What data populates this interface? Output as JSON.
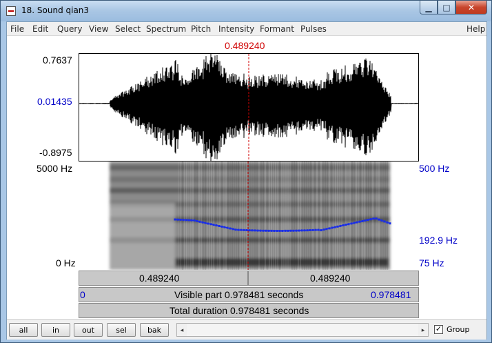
{
  "window": {
    "title": "18. Sound qian3",
    "controls": {
      "minimize": "▁",
      "maximize": "□",
      "close": "✕"
    }
  },
  "menu": [
    "File",
    "Edit",
    "Query",
    "View",
    "Select",
    "Spectrum",
    "Pitch",
    "Intensity",
    "Formant",
    "Pulses",
    "Help"
  ],
  "cursor": {
    "time_label": "0.489240",
    "position_fraction": 0.5,
    "color": "#d00000"
  },
  "waveform": {
    "max_label": "0.7637",
    "zero_label": "0.01435",
    "min_label": "-0.8975"
  },
  "spectrogram": {
    "freq_max_label": "5000 Hz",
    "freq_min_label": "0 Hz",
    "pitch_max_label": "500 Hz",
    "pitch_mid_label": "192.9 Hz",
    "pitch_min_label": "75 Hz",
    "pitch_color": "#1a2ee6"
  },
  "selection": {
    "left_label": "0.489240",
    "right_label": "0.489240"
  },
  "visible": {
    "start": "0",
    "text": "Visible part 0.978481 seconds",
    "end": "0.978481"
  },
  "total": {
    "text": "Total duration 0.978481 seconds"
  },
  "controls": {
    "all": "all",
    "in": "in",
    "out": "out",
    "sel": "sel",
    "bak": "bak",
    "group_label": "Group",
    "group_checked": "✓",
    "scroll_left": "◂",
    "scroll_right": "▸"
  }
}
